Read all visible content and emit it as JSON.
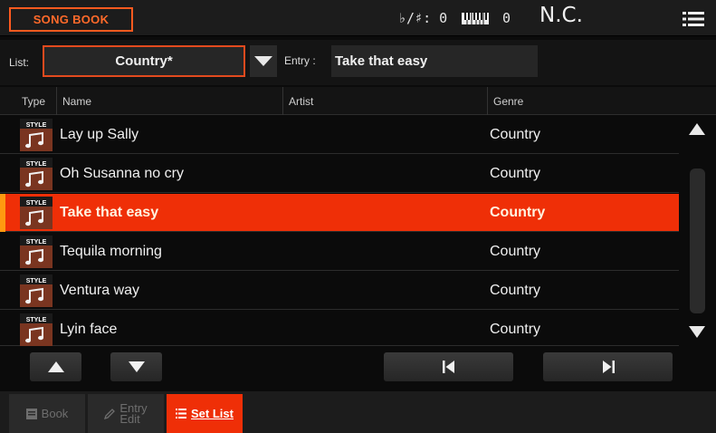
{
  "header": {
    "title": "SONG BOOK",
    "transpose": "♭/♯: 0",
    "octave": "0",
    "chord": "N.C."
  },
  "list_bar": {
    "list_label": "List:",
    "list_value": "Country*",
    "entry_label": "Entry :",
    "entry_value": "Take that easy"
  },
  "columns": {
    "type": "Type",
    "name": "Name",
    "artist": "Artist",
    "genre": "Genre"
  },
  "rows": [
    {
      "type_icon": "STYLE",
      "name": "Lay up Sally",
      "artist": "",
      "genre": "Country"
    },
    {
      "type_icon": "STYLE",
      "name": "Oh Susanna no cry",
      "artist": "",
      "genre": "Country"
    },
    {
      "type_icon": "STYLE",
      "name": "Take that easy",
      "artist": "",
      "genre": "Country",
      "selected": true
    },
    {
      "type_icon": "STYLE",
      "name": "Tequila morning",
      "artist": "",
      "genre": "Country"
    },
    {
      "type_icon": "STYLE",
      "name": "Ventura way",
      "artist": "",
      "genre": "Country"
    },
    {
      "type_icon": "STYLE",
      "name": "Lyin face",
      "artist": "",
      "genre": "Country"
    }
  ],
  "tabs": {
    "book": "Book",
    "entry_edit_1": "Entry",
    "entry_edit_2": "Edit",
    "set_list": "Set List"
  },
  "colors": {
    "accent": "#ef2f07",
    "title_orange": "#ff6a2a",
    "selection_marker": "#ff9a10"
  }
}
